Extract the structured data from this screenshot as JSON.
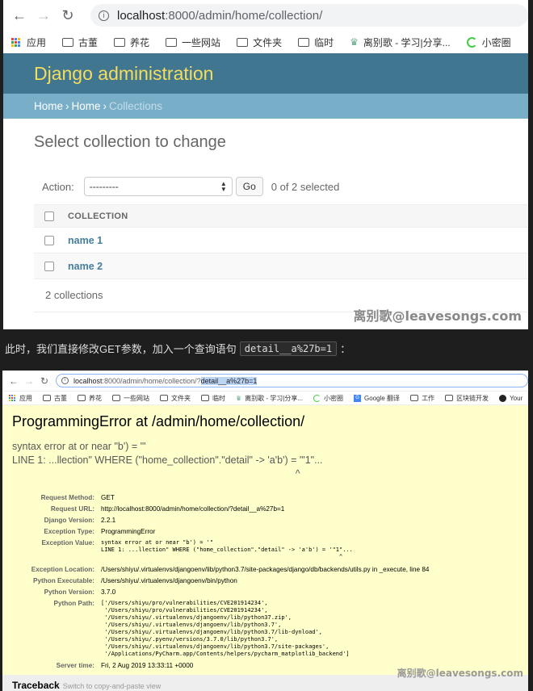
{
  "shot1": {
    "browser": {
      "url_host": "localhost",
      "url_rest": ":8000/admin/home/collection/",
      "bookmarks": [
        "应用",
        "古董",
        "养花",
        "一些网站",
        "文件夹",
        "临时",
        "离别歌 - 学习|分享...",
        "小密圈"
      ]
    },
    "site_title": "Django administration",
    "breadcrumb": {
      "home": "Home",
      "app": "Home",
      "current": "Collections",
      "sep": "›"
    },
    "heading": "Select collection to change",
    "action_label": "Action:",
    "action_select": "---------",
    "go_button": "Go",
    "selected_count": "0 of 2 selected",
    "column_header": "COLLECTION",
    "rows": [
      "name 1",
      "name 2"
    ],
    "result_count": "2 collections",
    "watermark": "离别歌@leavesongs.com"
  },
  "caption": {
    "text_before": "此时，我们直接修改GET参数，加入一个查询语句",
    "code": "detail__a%27b=1",
    "text_after": "："
  },
  "shot2": {
    "browser": {
      "url_host": "localhost",
      "url_rest": ":8000/admin/home/collection/?",
      "url_highlight": "detail__a%27b=1",
      "bookmarks": [
        "应用",
        "古董",
        "养花",
        "一些网站",
        "文件夹",
        "临时",
        "离别歌 - 学习|分享...",
        "小密圈",
        "Google 翻译",
        "工作",
        "区块链开发",
        "Your"
      ]
    },
    "error_title": "ProgrammingError at /admin/home/collection/",
    "error_value": "syntax error at or near \"b') = '\"\nLINE 1: ...llection\" WHERE (\"home_collection\".\"detail\" -> 'a'b') = '\"1\"...\n                                                                                                     ^",
    "meta": [
      {
        "label": "Request Method:",
        "value": "GET"
      },
      {
        "label": "Request URL:",
        "value": "http://localhost:8000/admin/home/collection/?detail__a%27b=1"
      },
      {
        "label": "Django Version:",
        "value": "2.2.1"
      },
      {
        "label": "Exception Type:",
        "value": "ProgrammingError"
      },
      {
        "label": "Exception Value:",
        "value": "syntax error at or near \"b') = '\"\nLINE 1: ...llection\" WHERE (\"home_collection\".\"detail\" -> 'a'b') = '\"1\"...\n                                                                      ^",
        "pre": true
      },
      {
        "label": "Exception Location:",
        "value": "/Users/shiyu/.virtualenvs/djangoenv/lib/python3.7/site-packages/django/db/backends/utils.py in _execute, line 84"
      },
      {
        "label": "Python Executable:",
        "value": "/Users/shiyu/.virtualenvs/djangoenv/bin/python"
      },
      {
        "label": "Python Version:",
        "value": "3.7.0"
      },
      {
        "label": "Python Path:",
        "value": "['/Users/shiyu/pro/vulnerabilities/CVE201914234',\n '/Users/shiyu/pro/vulnerabilities/CVE201914234',\n '/Users/shiyu/.virtualenvs/djangoenv/lib/python37.zip',\n '/Users/shiyu/.virtualenvs/djangoenv/lib/python3.7',\n '/Users/shiyu/.virtualenvs/djangoenv/lib/python3.7/lib-dynload',\n '/Users/shiyu/.pyenv/versions/3.7.0/lib/python3.7',\n '/Users/shiyu/.virtualenvs/djangoenv/lib/python3.7/site-packages',\n '/Applications/PyCharm.app/Contents/helpers/pycharm_matplotlib_backend']",
        "pre": true
      },
      {
        "label": "Server time:",
        "value": "Fri, 2 Aug 2019 13:33:11 +0000"
      }
    ],
    "traceback_title": "Traceback",
    "traceback_hint": "Switch to copy-and-paste view",
    "watermark": "离别歌@leavesongs.com"
  },
  "colors": {
    "django_header": "#417690",
    "django_title": "#f5dd5d",
    "breadcrumb_bg": "#79aec8",
    "link": "#447e9b",
    "error_bg": "#ffffcc"
  }
}
